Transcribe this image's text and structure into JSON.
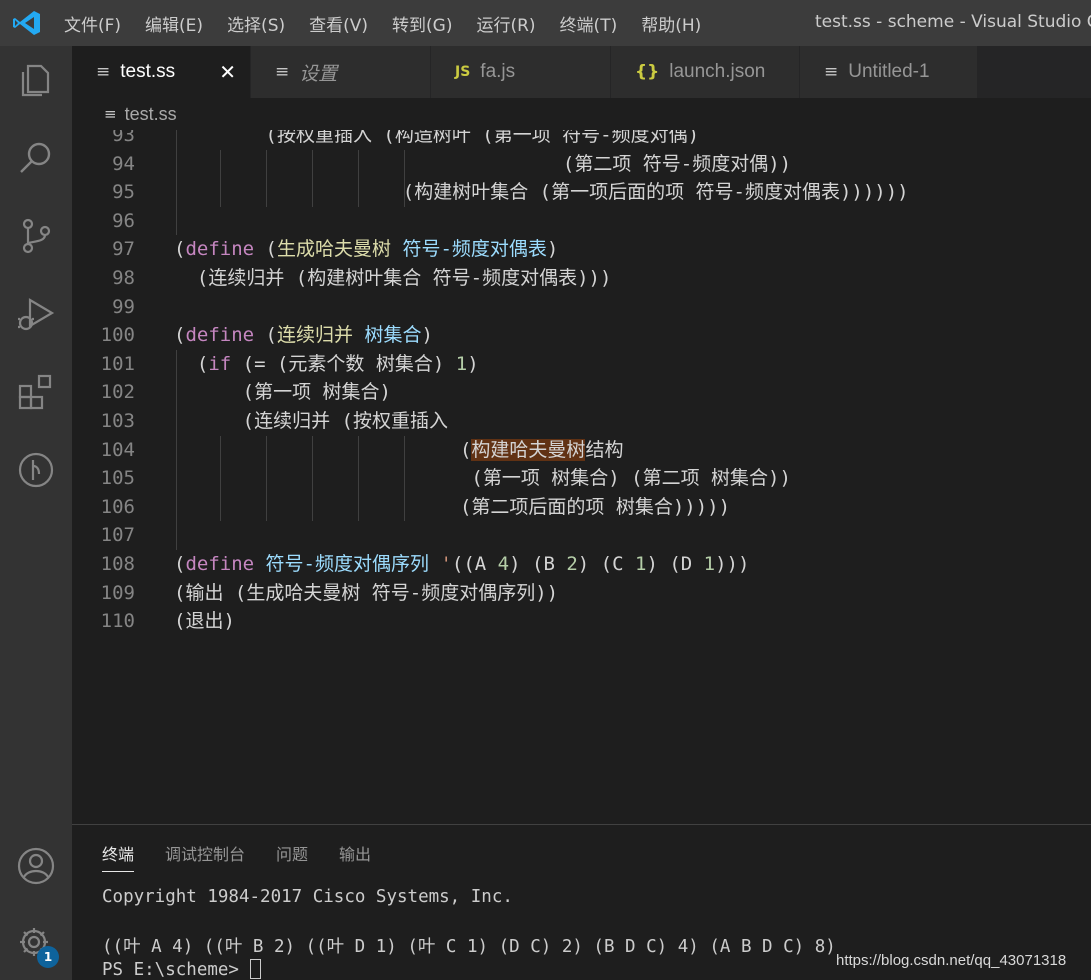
{
  "titlebar": {
    "menu": [
      "文件(F)",
      "编辑(E)",
      "选择(S)",
      "查看(V)",
      "转到(G)",
      "运行(R)",
      "终端(T)",
      "帮助(H)"
    ],
    "window_title": "test.ss - scheme - Visual Studio Code"
  },
  "activity_bar": {
    "icons": [
      "explorer-icon",
      "search-icon",
      "source-control-icon",
      "run-debug-icon",
      "extensions-icon",
      "remote-icon",
      "account-icon",
      "settings-gear-icon"
    ],
    "settings_badge": "1"
  },
  "tabs": [
    {
      "label": "test.ss",
      "icon": "file-lines-icon",
      "active": true
    },
    {
      "label": "设置",
      "icon": "file-lines-icon",
      "active": false
    },
    {
      "label": "fa.js",
      "icon": "js-icon",
      "active": false
    },
    {
      "label": "launch.json",
      "icon": "json-braces-icon",
      "active": false
    },
    {
      "label": "Untitled-1",
      "icon": "file-lines-icon",
      "active": false
    }
  ],
  "breadcrumb": {
    "file": "test.ss"
  },
  "editor": {
    "lines": [
      {
        "n": "93",
        "text": "        (按权重插入 (构造树叶 (第一项 符号-频度对偶)"
      },
      {
        "n": "94",
        "text": "                                  (第二项 符号-频度对偶))"
      },
      {
        "n": "95",
        "text": "                    (构建树叶集合 (第一项后面的项 符号-频度对偶表))))))"
      },
      {
        "n": "96",
        "text": ""
      },
      {
        "n": "97",
        "text": "(define (生成哈夫曼树 符号-频度对偶表)"
      },
      {
        "n": "98",
        "text": "  (连续归并 (构建树叶集合 符号-频度对偶表)))"
      },
      {
        "n": "99",
        "text": ""
      },
      {
        "n": "100",
        "text": "(define (连续归并 树集合)"
      },
      {
        "n": "101",
        "text": "  (if (= (元素个数 树集合) 1)"
      },
      {
        "n": "102",
        "text": "      (第一项 树集合)"
      },
      {
        "n": "103",
        "text": "      (连续归并 (按权重插入"
      },
      {
        "n": "104",
        "text": "                         (构建哈夫曼树结构"
      },
      {
        "n": "105",
        "text": "                          (第一项 树集合) (第二项 树集合))"
      },
      {
        "n": "106",
        "text": "                         (第二项后面的项 树集合)))))"
      },
      {
        "n": "107",
        "text": ""
      },
      {
        "n": "108",
        "text": "(define 符号-频度对偶序列 '((A 4) (B 2) (C 1) (D 1)))"
      },
      {
        "n": "109",
        "text": "(输出 (生成哈夫曼树 符号-频度对偶序列))"
      },
      {
        "n": "110",
        "text": "(退出)"
      }
    ]
  },
  "panel": {
    "tabs": [
      "终端",
      "调试控制台",
      "问题",
      "输出"
    ],
    "terminal_lines": [
      "Copyright 1984-2017 Cisco Systems, Inc.",
      "",
      "((叶 A 4) ((叶 B 2) ((叶 D 1) (叶 C 1) (D C) 2) (B D C) 4) (A B D C) 8)",
      "PS E:\\scheme> "
    ]
  },
  "watermark": "https://blog.csdn.net/qq_43071318"
}
